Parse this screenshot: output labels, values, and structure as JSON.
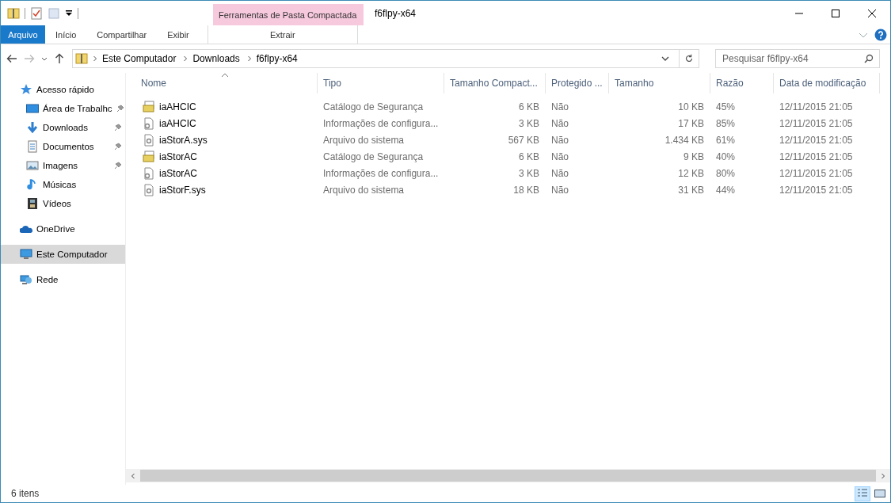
{
  "window": {
    "title": "f6flpy-x64"
  },
  "ribbon": {
    "context_group": "Ferramentas de Pasta Compactada",
    "tabs": [
      {
        "label": "Arquivo",
        "kind": "file",
        "selected": false
      },
      {
        "label": "Início",
        "kind": "normal",
        "selected": false
      },
      {
        "label": "Compartilhar",
        "kind": "normal",
        "selected": false
      },
      {
        "label": "Exibir",
        "kind": "normal",
        "selected": false
      },
      {
        "label": "Extrair",
        "kind": "contextual",
        "selected": false
      }
    ]
  },
  "address": {
    "path": [
      "Este Computador",
      "Downloads",
      "f6flpy-x64"
    ]
  },
  "search": {
    "placeholder": "Pesquisar f6flpy-x64"
  },
  "sidebar": {
    "sections": [
      {
        "label": "Acesso rápido",
        "selected": false,
        "children": [
          {
            "label": "Área de Trabalhc",
            "pinned": true,
            "selected": false
          },
          {
            "label": "Downloads",
            "pinned": true,
            "selected": false
          },
          {
            "label": "Documentos",
            "pinned": true,
            "selected": false
          },
          {
            "label": "Imagens",
            "pinned": true,
            "selected": false
          },
          {
            "label": "Músicas",
            "pinned": false,
            "selected": false
          },
          {
            "label": "Vídeos",
            "pinned": false,
            "selected": false
          }
        ]
      },
      {
        "label": "OneDrive",
        "selected": false
      },
      {
        "label": "Este Computador",
        "selected": true
      },
      {
        "label": "Rede",
        "selected": false
      }
    ]
  },
  "table": {
    "columns": [
      {
        "label": "Nome",
        "kind": "text",
        "sorted": true
      },
      {
        "label": "Tipo",
        "kind": "text",
        "sorted": false
      },
      {
        "label": "Tamanho Compact...",
        "kind": "number",
        "sorted": false
      },
      {
        "label": "Protegido ...",
        "kind": "text",
        "sorted": false
      },
      {
        "label": "Tamanho",
        "kind": "number",
        "sorted": false
      },
      {
        "label": "Razão",
        "kind": "text",
        "sorted": false
      },
      {
        "label": "Data de modificação",
        "kind": "text",
        "sorted": false
      }
    ],
    "rows": [
      {
        "kind": "catalog",
        "cells": [
          "iaAHCIC",
          "Catálogo de Segurança",
          "6 KB",
          "Não",
          "10 KB",
          "45%",
          "12/11/2015 21:05"
        ]
      },
      {
        "kind": "config",
        "cells": [
          "iaAHCIC",
          "Informações de configura...",
          "3 KB",
          "Não",
          "17 KB",
          "85%",
          "12/11/2015 21:05"
        ]
      },
      {
        "kind": "system",
        "cells": [
          "iaStorA.sys",
          "Arquivo do sistema",
          "567 KB",
          "Não",
          "1.434 KB",
          "61%",
          "12/11/2015 21:05"
        ]
      },
      {
        "kind": "catalog",
        "cells": [
          "iaStorAC",
          "Catálogo de Segurança",
          "6 KB",
          "Não",
          "9 KB",
          "40%",
          "12/11/2015 21:05"
        ]
      },
      {
        "kind": "config",
        "cells": [
          "iaStorAC",
          "Informações de configura...",
          "3 KB",
          "Não",
          "12 KB",
          "80%",
          "12/11/2015 21:05"
        ]
      },
      {
        "kind": "system",
        "cells": [
          "iaStorF.sys",
          "Arquivo do sistema",
          "18 KB",
          "Não",
          "31 KB",
          "44%",
          "12/11/2015 21:05"
        ]
      }
    ]
  },
  "status_bar": {
    "count": "6 itens",
    "views": [
      {
        "kind": "details",
        "selected": true
      },
      {
        "kind": "thumbnails",
        "selected": false
      }
    ]
  }
}
